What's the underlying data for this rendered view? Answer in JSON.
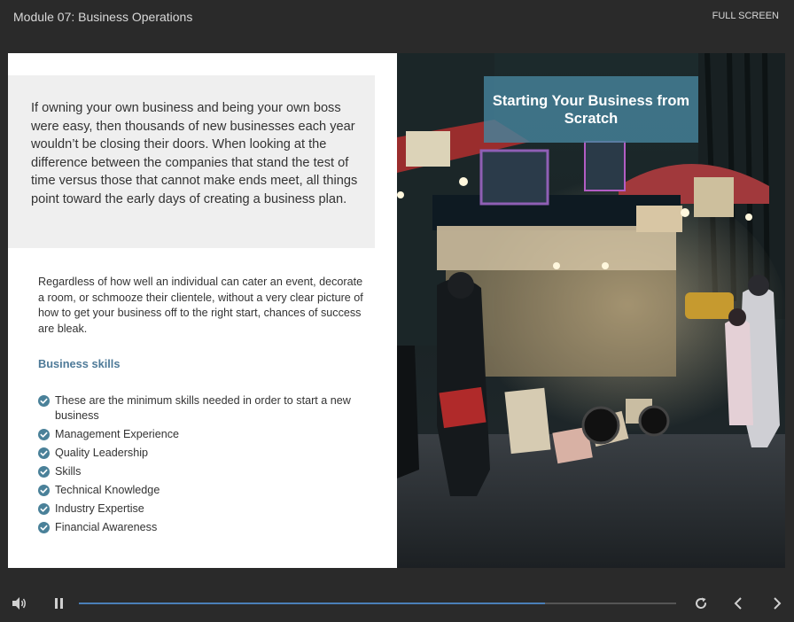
{
  "header": {
    "module_title": "Module 07: Business Operations",
    "fullscreen_label": "FULL SCREEN"
  },
  "slide": {
    "intro": "If owning your own business and being your own boss were easy, then thousands of new businesses each year wouldn’t be closing their doors. When looking at the difference between the companies that stand the test of time versus those that cannot make ends meet, all things point toward the early days of creating a business plan.",
    "body": "Regardless of how well an individual can cater an event, decorate a room, or schmooze their clientele, without a very clear picture of how to get your business off to the right start, chances of success are bleak.",
    "skills_heading": "Business skills",
    "skills": [
      "These are the minimum skills needed in order to start a new business",
      "Management Experience",
      "Quality Leadership",
      "Skills",
      "Technical Knowledge",
      "Industry Expertise",
      "Financial Awareness"
    ],
    "image_title": "Starting Your Business from Scratch"
  },
  "player": {
    "progress_fraction": 0.78,
    "icons": {
      "volume": "volume-icon",
      "pause": "pause-icon",
      "replay": "replay-icon",
      "prev": "chevron-left-icon",
      "next": "chevron-right-icon"
    }
  },
  "colors": {
    "accent": "#4e7a98",
    "check": "#4a8199",
    "progress": "#4a7fb8",
    "title_card": "#46829b"
  }
}
